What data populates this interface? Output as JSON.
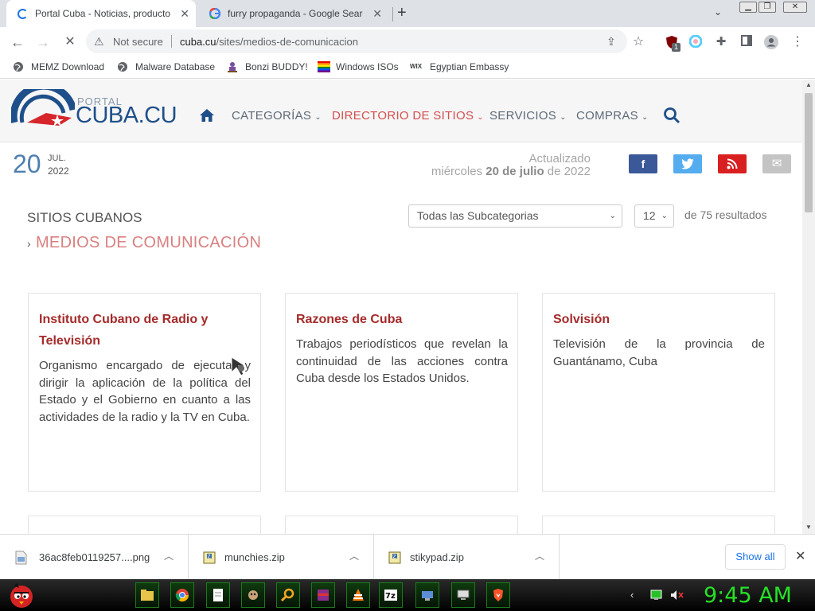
{
  "browser": {
    "tabs": [
      {
        "title": "Portal Cuba - Noticias, productos",
        "loading": true
      },
      {
        "title": "furry propaganda - Google Searc"
      }
    ],
    "new_tab": "+",
    "address": {
      "security": "Not secure",
      "host": "cuba.cu",
      "path": "/sites/medios-de-comunicacion"
    },
    "bookmarks": [
      "MEMZ Download",
      "Malware Database",
      "Bonzi BUDDY!",
      "Windows ISOs",
      "Egyptian Embassy"
    ],
    "extension_badge": "1"
  },
  "site": {
    "logo": {
      "portal": "PORTAL",
      "name": "CUBA.CU"
    },
    "nav": [
      "CATEGORÍAS",
      "DIRECTORIO DE SITIOS",
      "SERVICIOS",
      "COMPRAS"
    ],
    "date": {
      "day": "20",
      "month": "JUL.",
      "year": "2022"
    },
    "updated_label": "Actualizado",
    "updated_prefix": "miércoles ",
    "updated_date": "20 de julio",
    "updated_suffix": " de 2022",
    "social": {
      "facebook": "f",
      "twitter": "t",
      "rss": "rss",
      "email": "✉"
    },
    "section_label": "SITIOS CUBANOS",
    "section_title": "MEDIOS DE COMUNICACIÓN",
    "filter_subcategory": "Todas las Subcategorias",
    "per_page": "12",
    "results_text": "de 75 resultados",
    "cards": [
      {
        "title": "Instituto Cubano de Radio y Televisión",
        "desc": "Organismo encargado de ejecutar y dirigir la aplicación de la política del Estado y el Gobierno en cuanto a las actividades de la radio y la TV en Cuba."
      },
      {
        "title": "Razones de Cuba",
        "desc": "Trabajos periodísticos que revelan la continuidad de las acciones contra Cuba desde los Estados Unidos."
      },
      {
        "title": "Solvisión",
        "desc": "Televisión de la provincia de Guantánamo, Cuba"
      }
    ]
  },
  "downloads": {
    "items": [
      "36ac8feb0119257....png",
      "munchies.zip",
      "stikypad.zip"
    ],
    "show_all": "Show all"
  },
  "taskbar": {
    "clock": "9:45 AM"
  },
  "colors": {
    "brand_blue": "#1f4f8a",
    "brand_red": "#d54e4e",
    "card_title": "#a52b2b",
    "clock_green": "#26e026"
  }
}
